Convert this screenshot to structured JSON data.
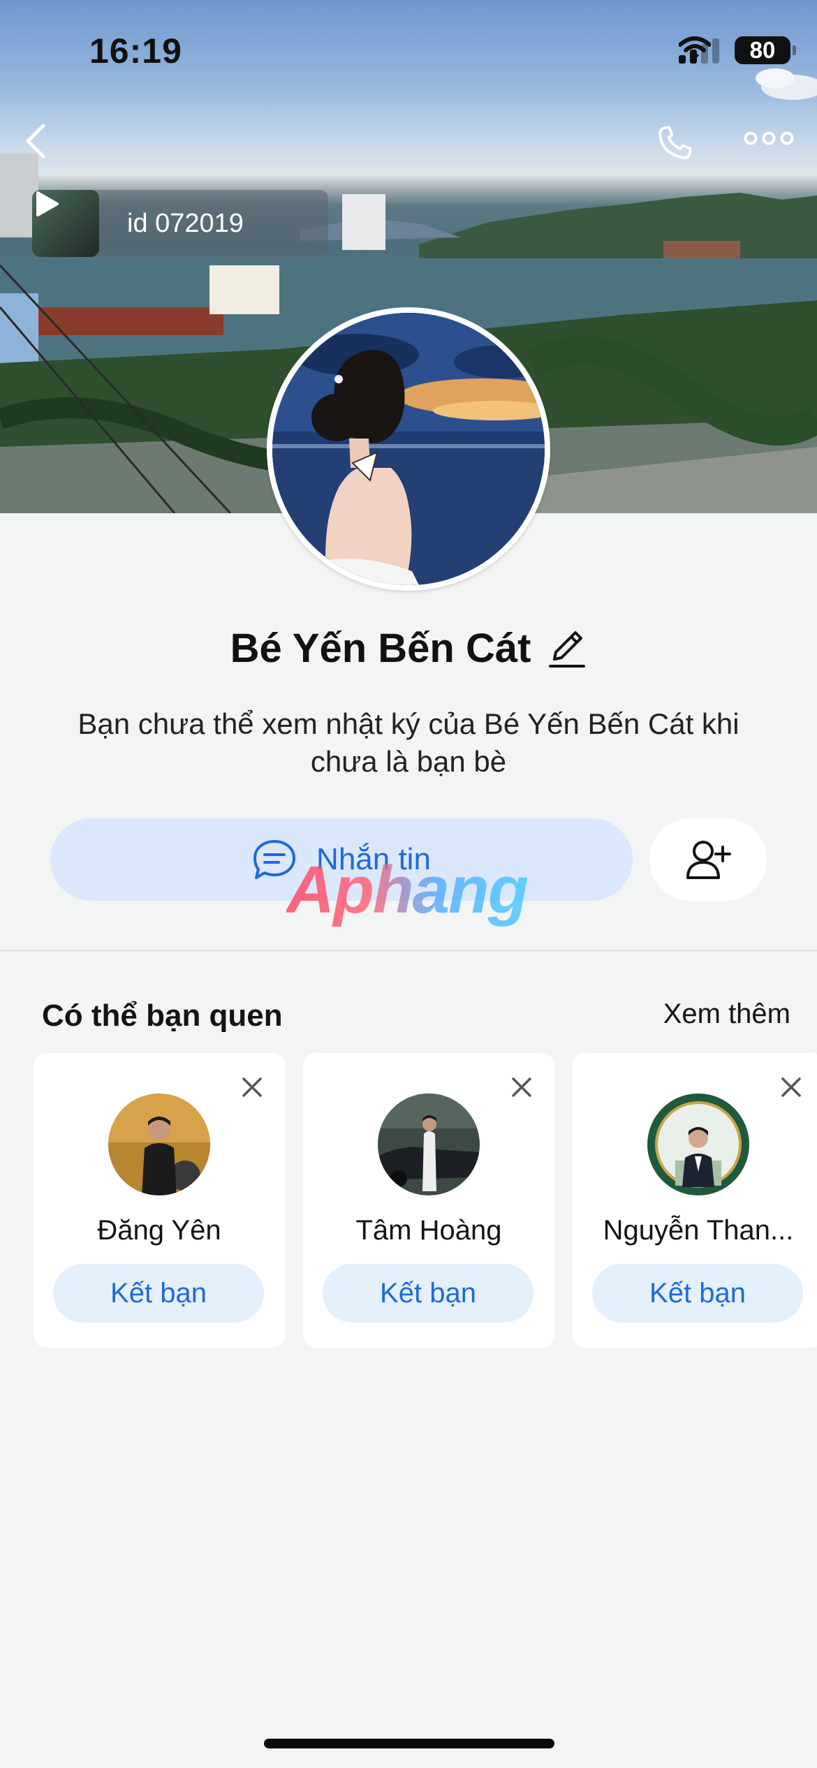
{
  "status_bar": {
    "time": "16:19",
    "battery": "80",
    "icons": [
      "signal-icon",
      "wifi-icon",
      "battery-icon"
    ]
  },
  "cover": {
    "video_label": "id 072019",
    "back_icon": "chevron-left-icon",
    "call_icon": "phone-icon",
    "more_icon": "more-horizontal-icon"
  },
  "profile": {
    "name": "Bé Yến Bến Cát",
    "note": "Bạn chưa thể xem nhật ký của Bé Yến Bến Cát khi chưa là bạn bè",
    "message_label": "Nhắn tin",
    "watermark": "Aphang"
  },
  "suggestions": {
    "title": "Có thể bạn quen",
    "see_more": "Xem thêm",
    "cards": [
      {
        "name": "Đăng Yên",
        "button": "Kết bạn"
      },
      {
        "name": "Tâm Hoàng",
        "button": "Kết bạn"
      },
      {
        "name": "Nguyễn Than...",
        "button": "Kết bạn"
      }
    ]
  },
  "colors": {
    "accent": "#1f69d9",
    "message_bg": "#dbe8fb",
    "chip_bg": "#e5f0fd",
    "page_bg": "#f3f4f4"
  }
}
